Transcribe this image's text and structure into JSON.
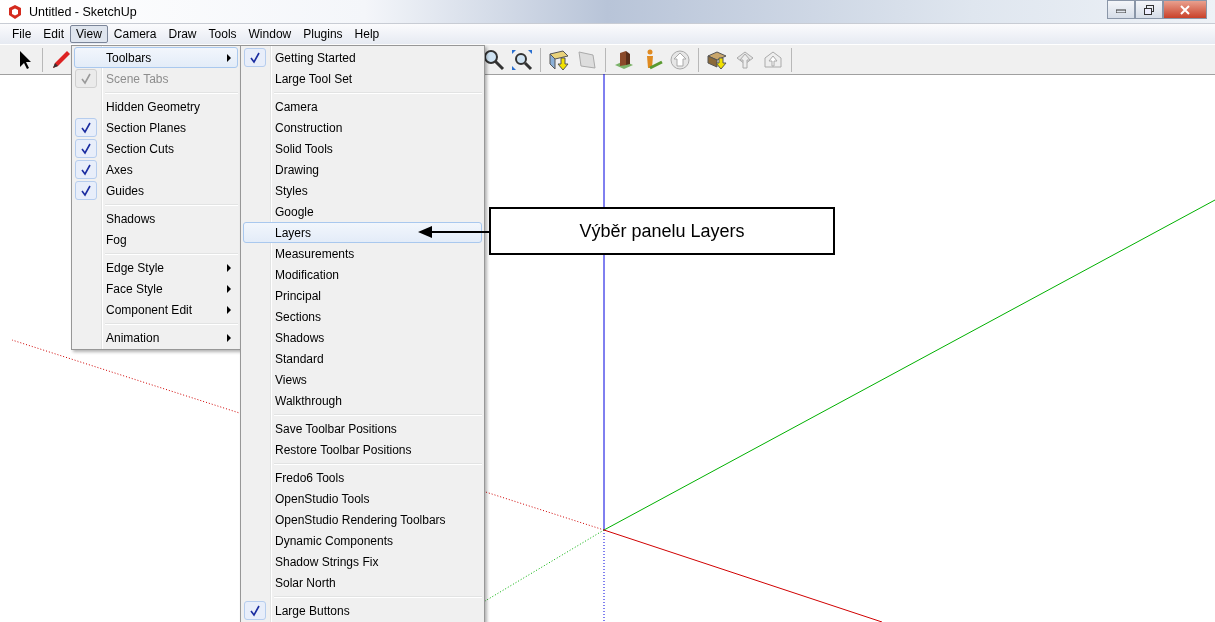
{
  "window": {
    "title": "Untitled - SketchUp"
  },
  "menu_bar": [
    {
      "label": "File",
      "selected": false
    },
    {
      "label": "Edit",
      "selected": false
    },
    {
      "label": "View",
      "selected": true
    },
    {
      "label": "Camera",
      "selected": false
    },
    {
      "label": "Draw",
      "selected": false
    },
    {
      "label": "Tools",
      "selected": false
    },
    {
      "label": "Window",
      "selected": false
    },
    {
      "label": "Plugins",
      "selected": false
    },
    {
      "label": "Help",
      "selected": false
    }
  ],
  "view_menu": {
    "sections": [
      [
        {
          "label": "Toolbars",
          "checked": false,
          "disabled": false,
          "submenu": true,
          "selected": true
        },
        {
          "label": "Scene Tabs",
          "checked": true,
          "disabled": true,
          "submenu": false,
          "selected": false
        }
      ],
      [
        {
          "label": "Hidden Geometry",
          "checked": false,
          "disabled": false,
          "submenu": false,
          "selected": false
        },
        {
          "label": "Section Planes",
          "checked": true,
          "disabled": false,
          "submenu": false,
          "selected": false
        },
        {
          "label": "Section Cuts",
          "checked": true,
          "disabled": false,
          "submenu": false,
          "selected": false
        },
        {
          "label": "Axes",
          "checked": true,
          "disabled": false,
          "submenu": false,
          "selected": false
        },
        {
          "label": "Guides",
          "checked": true,
          "disabled": false,
          "submenu": false,
          "selected": false
        }
      ],
      [
        {
          "label": "Shadows",
          "checked": false,
          "disabled": false,
          "submenu": false,
          "selected": false
        },
        {
          "label": "Fog",
          "checked": false,
          "disabled": false,
          "submenu": false,
          "selected": false
        }
      ],
      [
        {
          "label": "Edge Style",
          "checked": false,
          "disabled": false,
          "submenu": true,
          "selected": false
        },
        {
          "label": "Face Style",
          "checked": false,
          "disabled": false,
          "submenu": true,
          "selected": false
        },
        {
          "label": "Component Edit",
          "checked": false,
          "disabled": false,
          "submenu": true,
          "selected": false
        }
      ],
      [
        {
          "label": "Animation",
          "checked": false,
          "disabled": false,
          "submenu": true,
          "selected": false
        }
      ]
    ]
  },
  "toolbars_submenu": {
    "sections": [
      [
        {
          "label": "Getting Started",
          "checked": true,
          "disabled": false,
          "submenu": false,
          "selected": false
        },
        {
          "label": "Large Tool Set",
          "checked": false,
          "disabled": false,
          "submenu": false,
          "selected": false
        }
      ],
      [
        {
          "label": "Camera",
          "checked": false,
          "disabled": false,
          "submenu": false,
          "selected": false
        },
        {
          "label": "Construction",
          "checked": false,
          "disabled": false,
          "submenu": false,
          "selected": false
        },
        {
          "label": "Solid Tools",
          "checked": false,
          "disabled": false,
          "submenu": false,
          "selected": false
        },
        {
          "label": "Drawing",
          "checked": false,
          "disabled": false,
          "submenu": false,
          "selected": false
        },
        {
          "label": "Styles",
          "checked": false,
          "disabled": false,
          "submenu": false,
          "selected": false
        },
        {
          "label": "Google",
          "checked": false,
          "disabled": false,
          "submenu": false,
          "selected": false
        },
        {
          "label": "Layers",
          "checked": false,
          "disabled": false,
          "submenu": false,
          "selected": true
        },
        {
          "label": "Measurements",
          "checked": false,
          "disabled": false,
          "submenu": false,
          "selected": false
        },
        {
          "label": "Modification",
          "checked": false,
          "disabled": false,
          "submenu": false,
          "selected": false
        },
        {
          "label": "Principal",
          "checked": false,
          "disabled": false,
          "submenu": false,
          "selected": false
        },
        {
          "label": "Sections",
          "checked": false,
          "disabled": false,
          "submenu": false,
          "selected": false
        },
        {
          "label": "Shadows",
          "checked": false,
          "disabled": false,
          "submenu": false,
          "selected": false
        },
        {
          "label": "Standard",
          "checked": false,
          "disabled": false,
          "submenu": false,
          "selected": false
        },
        {
          "label": "Views",
          "checked": false,
          "disabled": false,
          "submenu": false,
          "selected": false
        },
        {
          "label": "Walkthrough",
          "checked": false,
          "disabled": false,
          "submenu": false,
          "selected": false
        }
      ],
      [
        {
          "label": "Save Toolbar Positions",
          "checked": false,
          "disabled": false,
          "submenu": false,
          "selected": false
        },
        {
          "label": "Restore Toolbar Positions",
          "checked": false,
          "disabled": false,
          "submenu": false,
          "selected": false
        }
      ],
      [
        {
          "label": "Fredo6 Tools",
          "checked": false,
          "disabled": false,
          "submenu": false,
          "selected": false
        },
        {
          "label": "OpenStudio Tools",
          "checked": false,
          "disabled": false,
          "submenu": false,
          "selected": false
        },
        {
          "label": "OpenStudio Rendering Toolbars",
          "checked": false,
          "disabled": false,
          "submenu": false,
          "selected": false
        },
        {
          "label": "Dynamic Components",
          "checked": false,
          "disabled": false,
          "submenu": false,
          "selected": false
        },
        {
          "label": "Shadow Strings Fix",
          "checked": false,
          "disabled": false,
          "submenu": false,
          "selected": false
        },
        {
          "label": "Solar North",
          "checked": false,
          "disabled": false,
          "submenu": false,
          "selected": false
        }
      ],
      [
        {
          "label": "Large Buttons",
          "checked": true,
          "disabled": false,
          "submenu": false,
          "selected": false
        }
      ]
    ]
  },
  "callout": {
    "text": "Výběr panelu Layers"
  }
}
